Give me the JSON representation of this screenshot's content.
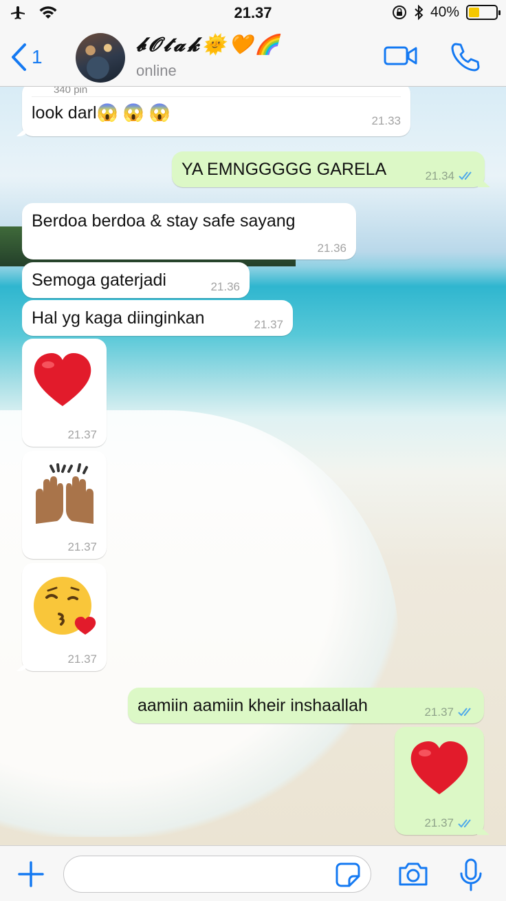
{
  "status_bar": {
    "time": "21.37",
    "battery_percent": "40%",
    "battery_level": 0.4
  },
  "header": {
    "back_count": "1",
    "contact_name": "𝓫𝓞𝓽𝓪𝓴🌞🧡🌈",
    "contact_status": "online"
  },
  "messages": [
    {
      "dir": "in",
      "quoted": "340 pin",
      "text": "look darl😱 😱 😱",
      "time": "21.33"
    },
    {
      "dir": "out",
      "text": "YA EMNGGGGG GARELA",
      "time": "21.34",
      "read": true
    },
    {
      "dir": "in",
      "text": "Berdoa berdoa & stay safe sayang",
      "time": "21.36"
    },
    {
      "dir": "in",
      "text": "Semoga gaterjadi",
      "time": "21.36"
    },
    {
      "dir": "in",
      "text": "Hal yg kaga diinginkan",
      "time": "21.37"
    },
    {
      "dir": "in",
      "emoji": "❤️",
      "time": "21.37"
    },
    {
      "dir": "in",
      "emoji": "🙌🏽",
      "time": "21.37"
    },
    {
      "dir": "in",
      "emoji": "😘",
      "time": "21.37"
    },
    {
      "dir": "out",
      "text": "aamiin aamiin kheir inshaallah",
      "time": "21.37",
      "read": true
    },
    {
      "dir": "out",
      "emoji": "❤️",
      "time": "21.37",
      "read": true
    }
  ],
  "input": {
    "placeholder": ""
  },
  "colors": {
    "accent": "#1479f2",
    "outgoing_bubble": "#dcf8c6",
    "incoming_bubble": "#ffffff",
    "read_ticks": "#4fa9ea"
  },
  "icons": [
    "airplane-icon",
    "wifi-icon",
    "rotation-lock-icon",
    "bluetooth-icon",
    "battery-icon",
    "back-chevron-icon",
    "video-call-icon",
    "phone-icon",
    "plus-icon",
    "sticker-icon",
    "camera-icon",
    "microphone-icon",
    "double-check-icon"
  ]
}
